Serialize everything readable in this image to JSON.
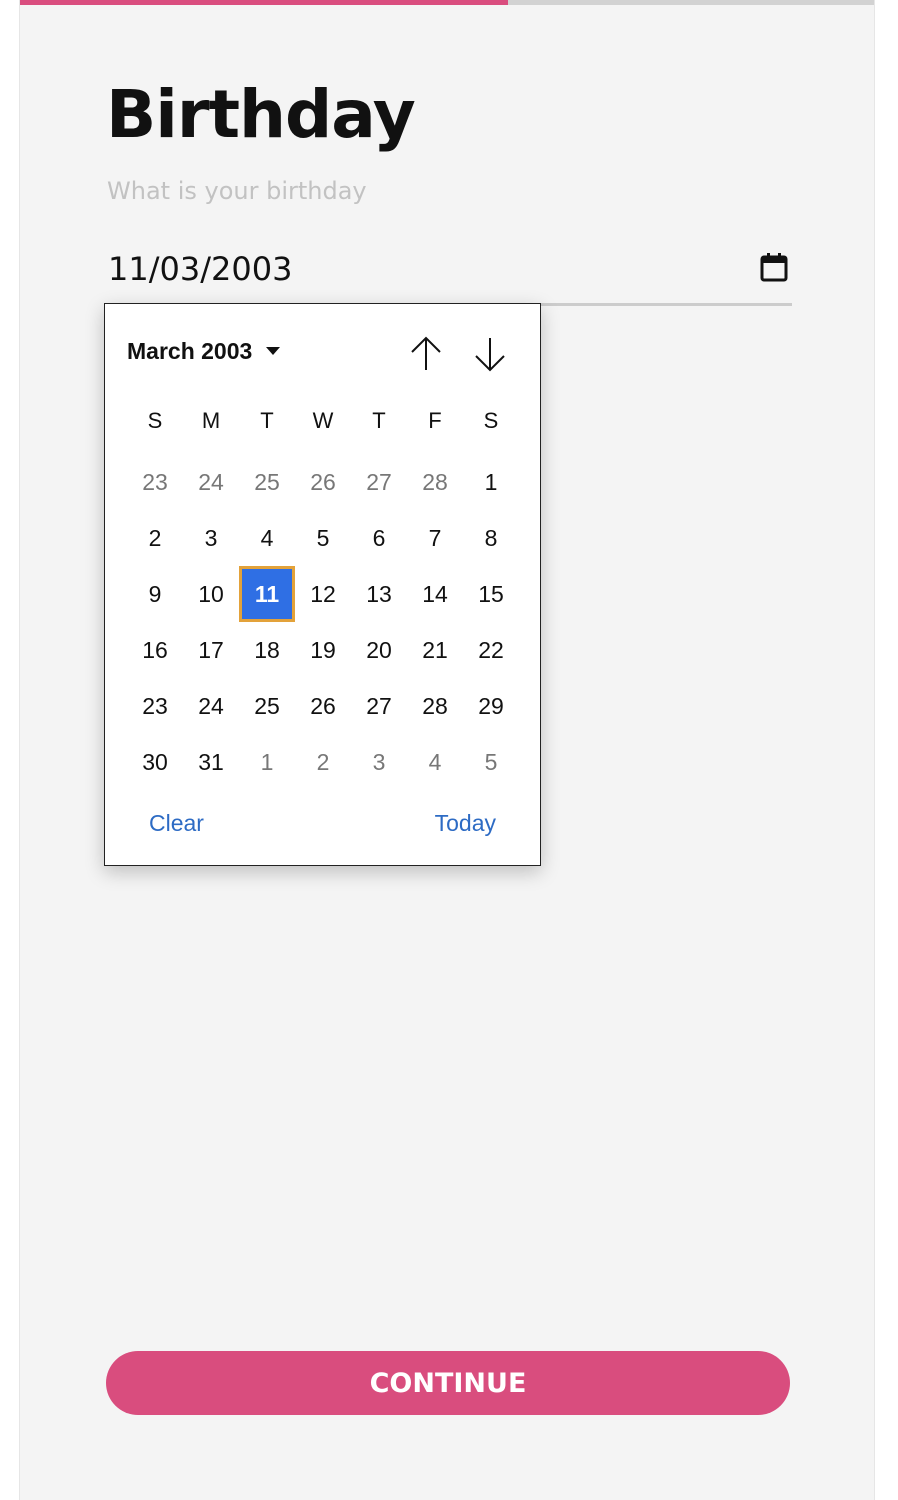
{
  "progress": {
    "fraction": 0.571,
    "fill_color": "#d94d7e"
  },
  "page": {
    "title": "Birthday",
    "subtitle": "What is your birthday"
  },
  "date_input": {
    "value": "11/03/2003",
    "icon": "calendar-icon"
  },
  "picker": {
    "month_label": "March 2003",
    "prev_icon": "arrow-up-icon",
    "next_icon": "arrow-down-icon",
    "weekdays": [
      "S",
      "M",
      "T",
      "W",
      "T",
      "F",
      "S"
    ],
    "weeks": [
      [
        {
          "d": "23",
          "m": true
        },
        {
          "d": "24",
          "m": true
        },
        {
          "d": "25",
          "m": true
        },
        {
          "d": "26",
          "m": true
        },
        {
          "d": "27",
          "m": true
        },
        {
          "d": "28",
          "m": true
        },
        {
          "d": "1",
          "m": false
        }
      ],
      [
        {
          "d": "2",
          "m": false
        },
        {
          "d": "3",
          "m": false
        },
        {
          "d": "4",
          "m": false
        },
        {
          "d": "5",
          "m": false
        },
        {
          "d": "6",
          "m": false
        },
        {
          "d": "7",
          "m": false
        },
        {
          "d": "8",
          "m": false
        }
      ],
      [
        {
          "d": "9",
          "m": false
        },
        {
          "d": "10",
          "m": false
        },
        {
          "d": "11",
          "m": false,
          "selected": true
        },
        {
          "d": "12",
          "m": false
        },
        {
          "d": "13",
          "m": false
        },
        {
          "d": "14",
          "m": false
        },
        {
          "d": "15",
          "m": false
        }
      ],
      [
        {
          "d": "16",
          "m": false
        },
        {
          "d": "17",
          "m": false
        },
        {
          "d": "18",
          "m": false
        },
        {
          "d": "19",
          "m": false
        },
        {
          "d": "20",
          "m": false
        },
        {
          "d": "21",
          "m": false
        },
        {
          "d": "22",
          "m": false
        }
      ],
      [
        {
          "d": "23",
          "m": false
        },
        {
          "d": "24",
          "m": false
        },
        {
          "d": "25",
          "m": false
        },
        {
          "d": "26",
          "m": false
        },
        {
          "d": "27",
          "m": false
        },
        {
          "d": "28",
          "m": false
        },
        {
          "d": "29",
          "m": false
        }
      ],
      [
        {
          "d": "30",
          "m": false
        },
        {
          "d": "31",
          "m": false
        },
        {
          "d": "1",
          "m": true
        },
        {
          "d": "2",
          "m": true
        },
        {
          "d": "3",
          "m": true
        },
        {
          "d": "4",
          "m": true
        },
        {
          "d": "5",
          "m": true
        }
      ]
    ],
    "clear_label": "Clear",
    "today_label": "Today",
    "colors": {
      "selected_bg": "#2f6fe4",
      "selected_border": "#e3a23a",
      "link": "#2d6bc4"
    }
  },
  "continue_label": "CONTINUE"
}
